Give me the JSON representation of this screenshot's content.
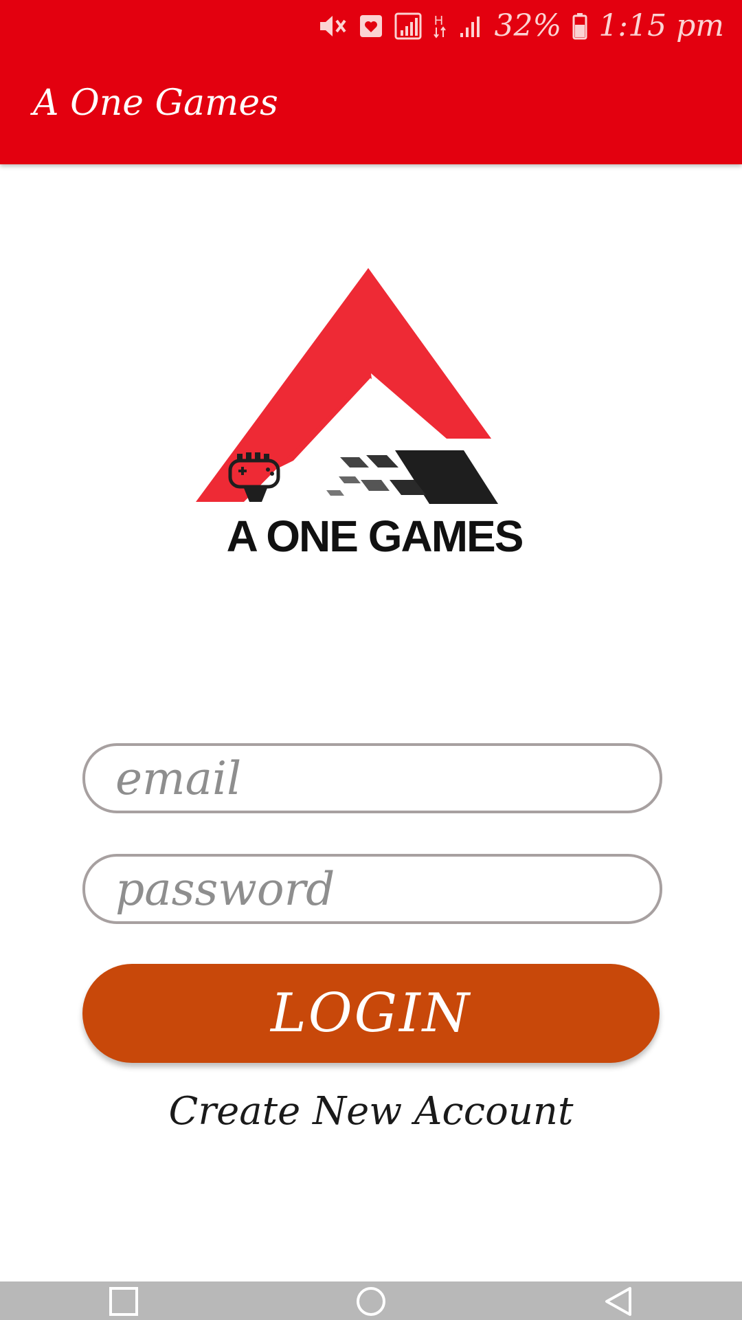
{
  "status_bar": {
    "battery_percent": "32%",
    "time": "1:15 pm",
    "icons": [
      "mute-icon",
      "notification-icon",
      "signal-icon",
      "h-network-icon",
      "signal-bars-icon",
      "battery-icon"
    ]
  },
  "app_bar": {
    "title": "A One Games"
  },
  "logo": {
    "text": "A ONE GAMES",
    "colors": {
      "primary_red": "#ee2a35",
      "dark": "#1e1e1e",
      "grey": "#555555"
    }
  },
  "form": {
    "email_placeholder": "email",
    "password_placeholder": "password",
    "login_label": "LOGIN",
    "create_account_label": "Create New Account"
  },
  "nav_bar": {
    "icons": [
      "recent-apps-icon",
      "home-icon",
      "back-icon"
    ]
  },
  "colors": {
    "app_bar": "#e3000f",
    "login_button": "#c8480a",
    "field_border": "#a7a0a0"
  }
}
